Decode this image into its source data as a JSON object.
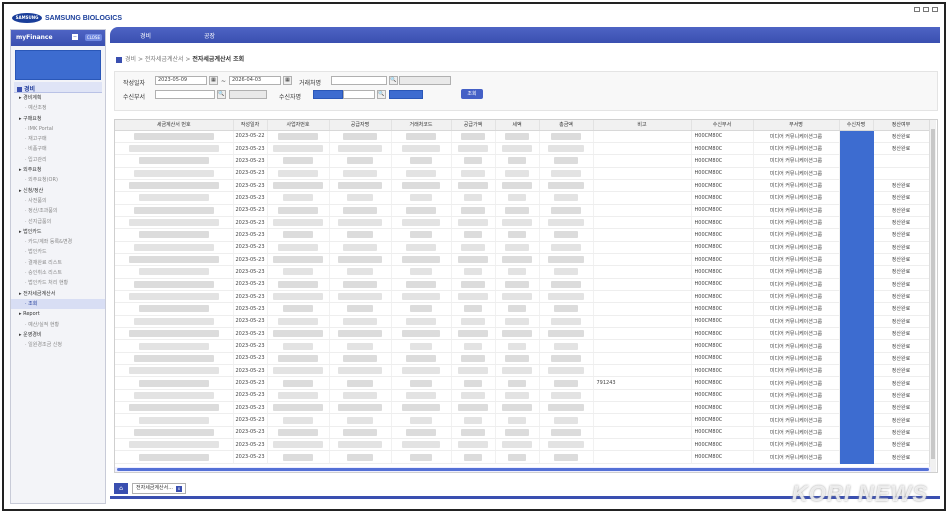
{
  "header": {
    "logo_mark": "SAMSUNG",
    "logo_text": "SAMSUNG BIOLOGICS"
  },
  "menubar": {
    "items": [
      "경비",
      "공장"
    ]
  },
  "sidebar": {
    "title": "myFinance",
    "close_label": "CLOSE",
    "minus_label": "−",
    "section": "경비",
    "items": [
      {
        "label": "▸ 경비계획",
        "sub": false
      },
      {
        "label": "· 예산조정",
        "sub": true
      },
      {
        "label": "▸ 구매요청",
        "sub": false
      },
      {
        "label": "· IMK Portal",
        "sub": true
      },
      {
        "label": "· 재고구매",
        "sub": true
      },
      {
        "label": "· 비품구매",
        "sub": true
      },
      {
        "label": "· 입고관리",
        "sub": true
      },
      {
        "label": "▸ 외주요청",
        "sub": false
      },
      {
        "label": "· 외주요청(OR)",
        "sub": true
      },
      {
        "label": "▸ 신청/정산",
        "sub": false
      },
      {
        "label": "· 사전품의",
        "sub": true
      },
      {
        "label": "· 정산/조과품의",
        "sub": true
      },
      {
        "label": "· 선지급품의",
        "sub": true
      },
      {
        "label": "▸ 법인카드",
        "sub": false
      },
      {
        "label": "· 카드/계좌 등록&변경",
        "sub": true
      },
      {
        "label": "· 법인카드",
        "sub": true
      },
      {
        "label": "· 결재완료 리스트",
        "sub": true
      },
      {
        "label": "· 승인취소 리스트",
        "sub": true
      },
      {
        "label": "· 법인카드 처리 현황",
        "sub": true
      },
      {
        "label": "▸ 전자세금계산서",
        "sub": false
      },
      {
        "label": "· 조회",
        "sub": true,
        "active": true
      },
      {
        "label": "▸ Report",
        "sub": false
      },
      {
        "label": "· 예산/실적 현황",
        "sub": true
      },
      {
        "label": "▸ 운영경비",
        "sub": false
      },
      {
        "label": "· 일원경조금 신청",
        "sub": true
      }
    ]
  },
  "breadcrumb": {
    "path": "경비 > 전자세금계산서 > ",
    "current": "전자세금계산서 조회"
  },
  "filter": {
    "date_label": "작성일자",
    "date_from": "2023-05-09",
    "date_sep": "~",
    "date_to": "2026-04-03",
    "partner_label": "거래처명",
    "dept_label": "수신부서",
    "receiver_label": "수신자명",
    "search_button": "조회",
    "search_icon": "🔍"
  },
  "table": {
    "columns": [
      "세금계산서 번호",
      "작성일자",
      "사업자번호",
      "공급자명",
      "거래처코드",
      "공급가액",
      "세액",
      "총금액",
      "비고",
      "수신부서",
      "부서명",
      "수신자명",
      "정산여부"
    ],
    "rows": [
      {
        "date": "2023-05-22",
        "note": "",
        "dept": "H00CM80C",
        "dept_name": "미디어 커뮤니케이션그룹",
        "status": "정산완료"
      },
      {
        "date": "2023-05-23",
        "note": "",
        "dept": "H00CM80C",
        "dept_name": "미디어 커뮤니케이션그룹",
        "status": "정산완료"
      },
      {
        "date": "2023-05-23",
        "note": "",
        "dept": "H00CM80C",
        "dept_name": "미디어 커뮤니케이션그룹",
        "status": ""
      },
      {
        "date": "2023-05-23",
        "note": "",
        "dept": "H00CM80C",
        "dept_name": "미디어 커뮤니케이션그룹",
        "status": ""
      },
      {
        "date": "2023-05-23",
        "note": "",
        "dept": "H00CM80C",
        "dept_name": "미디어 커뮤니케이션그룹",
        "status": "정산완료"
      },
      {
        "date": "2023-05-23",
        "note": "",
        "dept": "H00CM80C",
        "dept_name": "미디어 커뮤니케이션그룹",
        "status": "정산완료"
      },
      {
        "date": "2023-05-23",
        "note": "",
        "dept": "H00CM80C",
        "dept_name": "미디어 커뮤니케이션그룹",
        "status": "정산완료"
      },
      {
        "date": "2023-05-23",
        "note": "",
        "dept": "H00CM80C",
        "dept_name": "미디어 커뮤니케이션그룹",
        "status": "정산완료"
      },
      {
        "date": "2023-05-23",
        "note": "",
        "dept": "H00CM80C",
        "dept_name": "미디어 커뮤니케이션그룹",
        "status": "정산완료"
      },
      {
        "date": "2023-05-23",
        "note": "",
        "dept": "H00CM80C",
        "dept_name": "미디어 커뮤니케이션그룹",
        "status": "정산완료"
      },
      {
        "date": "2023-05-23",
        "note": "",
        "dept": "H00CM80C",
        "dept_name": "미디어 커뮤니케이션그룹",
        "status": "정산완료"
      },
      {
        "date": "2023-05-23",
        "note": "",
        "dept": "H00CM80C",
        "dept_name": "미디어 커뮤니케이션그룹",
        "status": "정산완료"
      },
      {
        "date": "2023-05-23",
        "note": "",
        "dept": "H00CM80C",
        "dept_name": "미디어 커뮤니케이션그룹",
        "status": "정산완료"
      },
      {
        "date": "2023-05-23",
        "note": "",
        "dept": "H00CM80C",
        "dept_name": "미디어 커뮤니케이션그룹",
        "status": "정산완료"
      },
      {
        "date": "2023-05-23",
        "note": "",
        "dept": "H00CM80C",
        "dept_name": "미디어 커뮤니케이션그룹",
        "status": "정산완료"
      },
      {
        "date": "2023-05-23",
        "note": "",
        "dept": "H00CM80C",
        "dept_name": "미디어 커뮤니케이션그룹",
        "status": "정산완료"
      },
      {
        "date": "2023-05-23",
        "note": "",
        "dept": "H00CM80C",
        "dept_name": "미디어 커뮤니케이션그룹",
        "status": "정산완료"
      },
      {
        "date": "2023-05-23",
        "note": "",
        "dept": "H00CM80C",
        "dept_name": "미디어 커뮤니케이션그룹",
        "status": "정산완료"
      },
      {
        "date": "2023-05-23",
        "note": "",
        "dept": "H00CM80C",
        "dept_name": "미디어 커뮤니케이션그룹",
        "status": "정산완료"
      },
      {
        "date": "2023-05-23",
        "note": "",
        "dept": "H00CM80C",
        "dept_name": "미디어 커뮤니케이션그룹",
        "status": "정산완료"
      },
      {
        "date": "2023-05-23",
        "note": "791243",
        "dept": "H00CM80C",
        "dept_name": "미디어 커뮤니케이션그룹",
        "status": "정산완료"
      },
      {
        "date": "2023-05-23",
        "note": "",
        "dept": "H00CM80C",
        "dept_name": "미디어 커뮤니케이션그룹",
        "status": "정산완료"
      },
      {
        "date": "2023-05-23",
        "note": "",
        "dept": "H00CM80C",
        "dept_name": "미디어 커뮤니케이션그룹",
        "status": "정산완료"
      },
      {
        "date": "2023-05-23",
        "note": "",
        "dept": "H00CM80C",
        "dept_name": "미디어 커뮤니케이션그룹",
        "status": "정산완료"
      },
      {
        "date": "2023-05-23",
        "note": "",
        "dept": "H00CM80C",
        "dept_name": "미디어 커뮤니케이션그룹",
        "status": "정산완료"
      },
      {
        "date": "2023-05-23",
        "note": "",
        "dept": "H00CM80C",
        "dept_name": "미디어 커뮤니케이션그룹",
        "status": "정산완료"
      },
      {
        "date": "2023-05-23",
        "note": "",
        "dept": "H00CM80C",
        "dept_name": "미디어 커뮤니케이션그룹",
        "status": "정산완료"
      }
    ]
  },
  "tabs": {
    "home_icon": "⌂",
    "open_tab": "전자세금계산서...",
    "close_icon": "x"
  },
  "watermark": "KORI NEWS",
  "colors": {
    "accent": "#3a4fb0",
    "redaction": "#3d6cd0"
  }
}
